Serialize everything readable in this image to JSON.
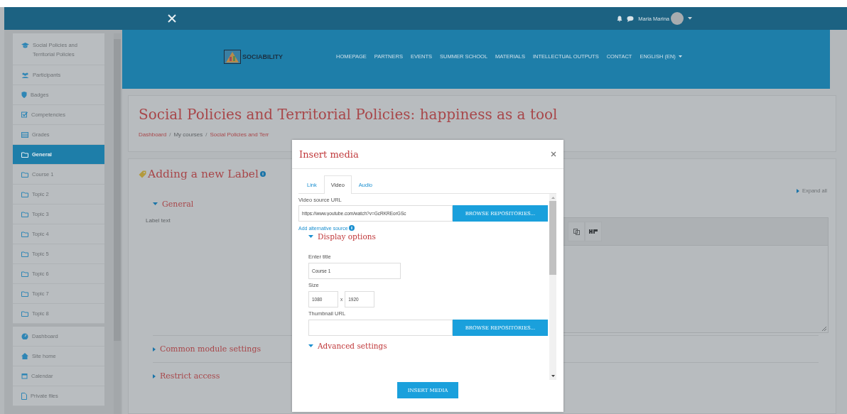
{
  "top_bar": {
    "user_name": "Maria Marina"
  },
  "sidebar": {
    "groups": [
      {
        "items": [
          {
            "label": "Social Policies and Territorial Policies",
            "kind": "course",
            "selected": false
          },
          {
            "label": "Participants",
            "kind": "participants",
            "selected": false
          },
          {
            "label": "Badges",
            "kind": "badges",
            "selected": false
          },
          {
            "label": "Competencies",
            "kind": "competencies",
            "selected": false
          },
          {
            "label": "Grades",
            "kind": "grades",
            "selected": false
          },
          {
            "label": "General",
            "kind": "section",
            "selected": true
          },
          {
            "label": "Course 1",
            "kind": "section",
            "selected": false
          },
          {
            "label": "Topic 2",
            "kind": "section",
            "selected": false
          },
          {
            "label": "Topic 3",
            "kind": "section",
            "selected": false
          },
          {
            "label": "Topic 4",
            "kind": "section",
            "selected": false
          },
          {
            "label": "Topic 5",
            "kind": "section",
            "selected": false
          },
          {
            "label": "Topic 6",
            "kind": "section",
            "selected": false
          },
          {
            "label": "Topic 7",
            "kind": "section",
            "selected": false
          },
          {
            "label": "Topic 8",
            "kind": "section",
            "selected": false
          }
        ]
      },
      {
        "items": [
          {
            "label": "Dashboard",
            "kind": "dashboard",
            "selected": false
          },
          {
            "label": "Site home",
            "kind": "home",
            "selected": false
          },
          {
            "label": "Calendar",
            "kind": "calendar",
            "selected": false
          },
          {
            "label": "Private files",
            "kind": "files",
            "selected": false
          }
        ]
      }
    ]
  },
  "header": {
    "logo_text": "SOCIABILITY",
    "nav": [
      {
        "label": "HOMEPAGE",
        "dropdown": false
      },
      {
        "label": "PARTNERS",
        "dropdown": false
      },
      {
        "label": "EVENTS",
        "dropdown": false
      },
      {
        "label": "SUMMER SCHOOL",
        "dropdown": false
      },
      {
        "label": "MATERIALS",
        "dropdown": false
      },
      {
        "label": "INTELLECTUAL OUTPUTS",
        "dropdown": false
      },
      {
        "label": "CONTACT",
        "dropdown": false
      },
      {
        "label": "ENGLISH (EN)",
        "dropdown": true
      }
    ]
  },
  "course_header": {
    "title": "Social Policies and Territorial Policies: happiness as a tool",
    "breadcrumb": [
      {
        "label": "Dashboard"
      },
      {
        "separator": "/",
        "label": "My courses"
      },
      {
        "separator": "/",
        "label": "Social Policies and Terr"
      }
    ]
  },
  "form": {
    "heading": "Adding a new Label",
    "expand_all": "Expand all",
    "label_text": "Label text",
    "sections": [
      {
        "label": "General",
        "expanded": true
      },
      {
        "label": "Common module settings",
        "expanded": false
      },
      {
        "label": "Restrict access",
        "expanded": false
      }
    ]
  },
  "modal": {
    "title": "Insert media",
    "tabs": [
      {
        "label": "Link",
        "selected": false
      },
      {
        "label": "Video",
        "selected": true
      },
      {
        "label": "Audio",
        "selected": false
      }
    ],
    "video_source_label": "Video source URL",
    "video_source_value": "https://www.youtube.com/watch?v=GcRKREorGSc",
    "browse_button": "BROWSE REPOSITORIES...",
    "add_alternative": "Add alternative source",
    "display_options": {
      "label": "Display options",
      "expanded": true
    },
    "enter_title_label": "Enter title",
    "title_value": "Course 1",
    "size_label": "Size",
    "width_value": "1080",
    "size_separator": "x",
    "height_value": "1920",
    "thumbnail_label": "Thumbnail URL",
    "thumbnail_browse_button": "BROWSE REPOSITORIES...",
    "advanced_settings": {
      "label": "Advanced settings",
      "expanded": true
    },
    "insert_button": "INSERT MEDIA"
  }
}
